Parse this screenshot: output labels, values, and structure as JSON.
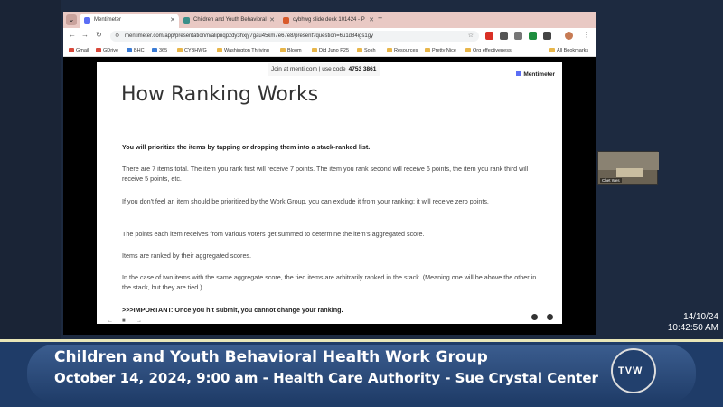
{
  "browser": {
    "tabs": [
      {
        "label": "Mentimeter",
        "active": true,
        "favicon_color": "#5b6ef5"
      },
      {
        "label": "Children and Youth Behavioral",
        "active": false,
        "favicon_color": "#3a8f8a"
      },
      {
        "label": "cybhwg slide deck 101424 - P",
        "active": false,
        "favicon_color": "#d95a2b"
      }
    ],
    "new_tab": "+",
    "url": "mentimeter.com/app/presentation/n/alipnqpzdy3hxjy7gau45km7e67e8/present?question=6u1d84igs1gy",
    "bookmarks": [
      {
        "label": "Gmail",
        "kind": "g"
      },
      {
        "label": "GDrive",
        "kind": "g"
      },
      {
        "label": "BHC",
        "kind": "o"
      },
      {
        "label": "365",
        "kind": "o"
      },
      {
        "label": "CYBHWG",
        "kind": "f"
      },
      {
        "label": "Washington Thriving",
        "kind": "f"
      },
      {
        "label": "Bloom",
        "kind": "f"
      },
      {
        "label": "Did Juno P25",
        "kind": "f"
      },
      {
        "label": "Sosh",
        "kind": "f"
      },
      {
        "label": "Resources",
        "kind": "f"
      },
      {
        "label": "Pretty Nice",
        "kind": "f"
      },
      {
        "label": "Org effectiveness",
        "kind": "f"
      }
    ],
    "all_bookmarks": "All Bookmarks"
  },
  "slide": {
    "join_text": "Join at menti.com | use code",
    "join_code": "4753 3861",
    "brand": "Mentimeter",
    "title": "How Ranking Works",
    "paragraphs": [
      "You will prioritize the items by tapping or dropping them into a stack-ranked list.",
      "There are 7 items total. The item you rank first will receive 7 points. The item  you rank second will receive 6 points, the item you rank third will receive 5 points, etc.",
      "If you don't feel an item should be prioritized by the Work Group, you can exclude it from your ranking; it will receive zero points.",
      "The points each item receives from various voters get summed to determine the item's aggregated score.",
      "Items are ranked by their aggregated scores.",
      "In the case of two items with the same aggregate score, the tied items are arbitrarily ranked in the stack. (Meaning one will be above the other in the stack, but they are tied.)",
      ">>>IMPORTANT: Once you hit submit, you cannot change your ranking."
    ]
  },
  "webcam": {
    "label": "Chet Wes"
  },
  "clock": {
    "date": "14/10/24",
    "time": "10:42:50 AM"
  },
  "banner": {
    "title": "Children and Youth Behavioral Health Work Group",
    "subtitle": "October 14, 2024, 9:00 am - Health Care Authority - Sue Crystal Center",
    "logo_text": "TVW"
  }
}
